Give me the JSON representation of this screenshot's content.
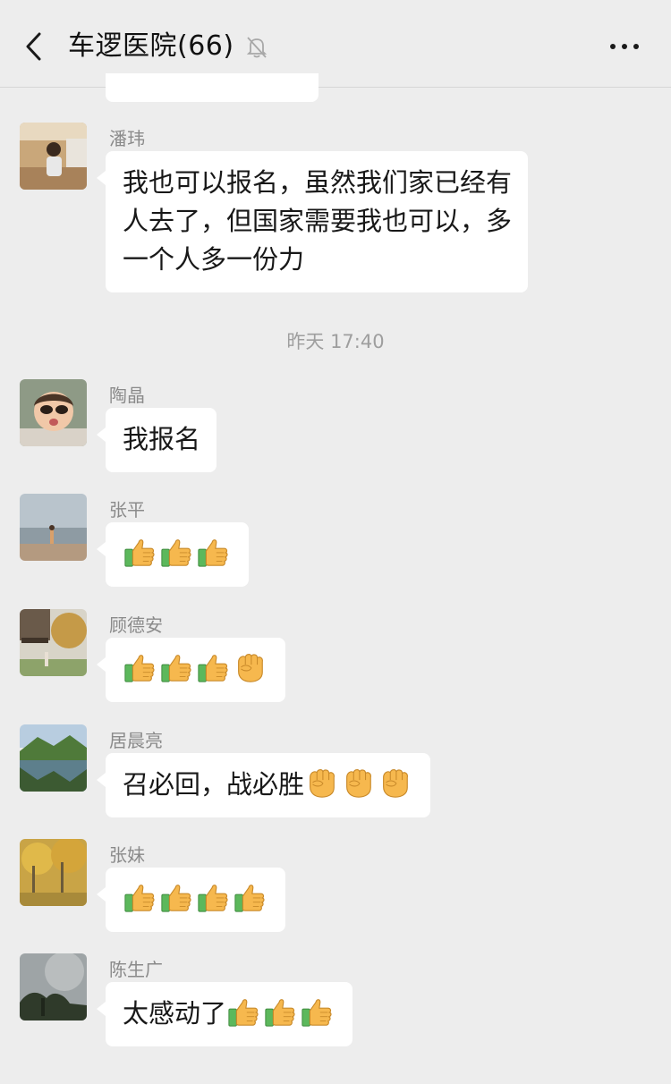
{
  "header": {
    "title": "车逻医院(66)",
    "back_icon": "chevron-left-icon",
    "mute_icon": "bell-mute-icon",
    "more_icon": "more-dots-icon"
  },
  "timestamp": "昨天 17:40",
  "messages": [
    {
      "sender": "潘玮",
      "lines": [
        "我也可以报名，虽然我们家已经有",
        "人去了，但国家需要我也可以，多",
        "一个人多一份力"
      ]
    },
    {
      "sender": "陶晶",
      "text": "我报名"
    },
    {
      "sender": "张平",
      "emojis": [
        "thumbs-up",
        "thumbs-up",
        "thumbs-up"
      ]
    },
    {
      "sender": "顾德安",
      "emojis": [
        "thumbs-up",
        "thumbs-up",
        "thumbs-up",
        "fist"
      ]
    },
    {
      "sender": "居晨亮",
      "text": "召必回，战必胜",
      "emojis": [
        "fist",
        "fist",
        "fist"
      ]
    },
    {
      "sender": "张妹",
      "emojis": [
        "thumbs-up",
        "thumbs-up",
        "thumbs-up",
        "thumbs-up"
      ]
    },
    {
      "sender": "陈生广",
      "text": "太感动了",
      "emojis": [
        "thumbs-up",
        "thumbs-up",
        "thumbs-up"
      ]
    }
  ],
  "colors": {
    "background": "#ededed",
    "bubble": "#ffffff",
    "sender_name": "#8a8a8a",
    "timestamp": "#9e9e9e",
    "emoji_skin": "#f6b84e",
    "emoji_cuff": "#5cb85c"
  }
}
